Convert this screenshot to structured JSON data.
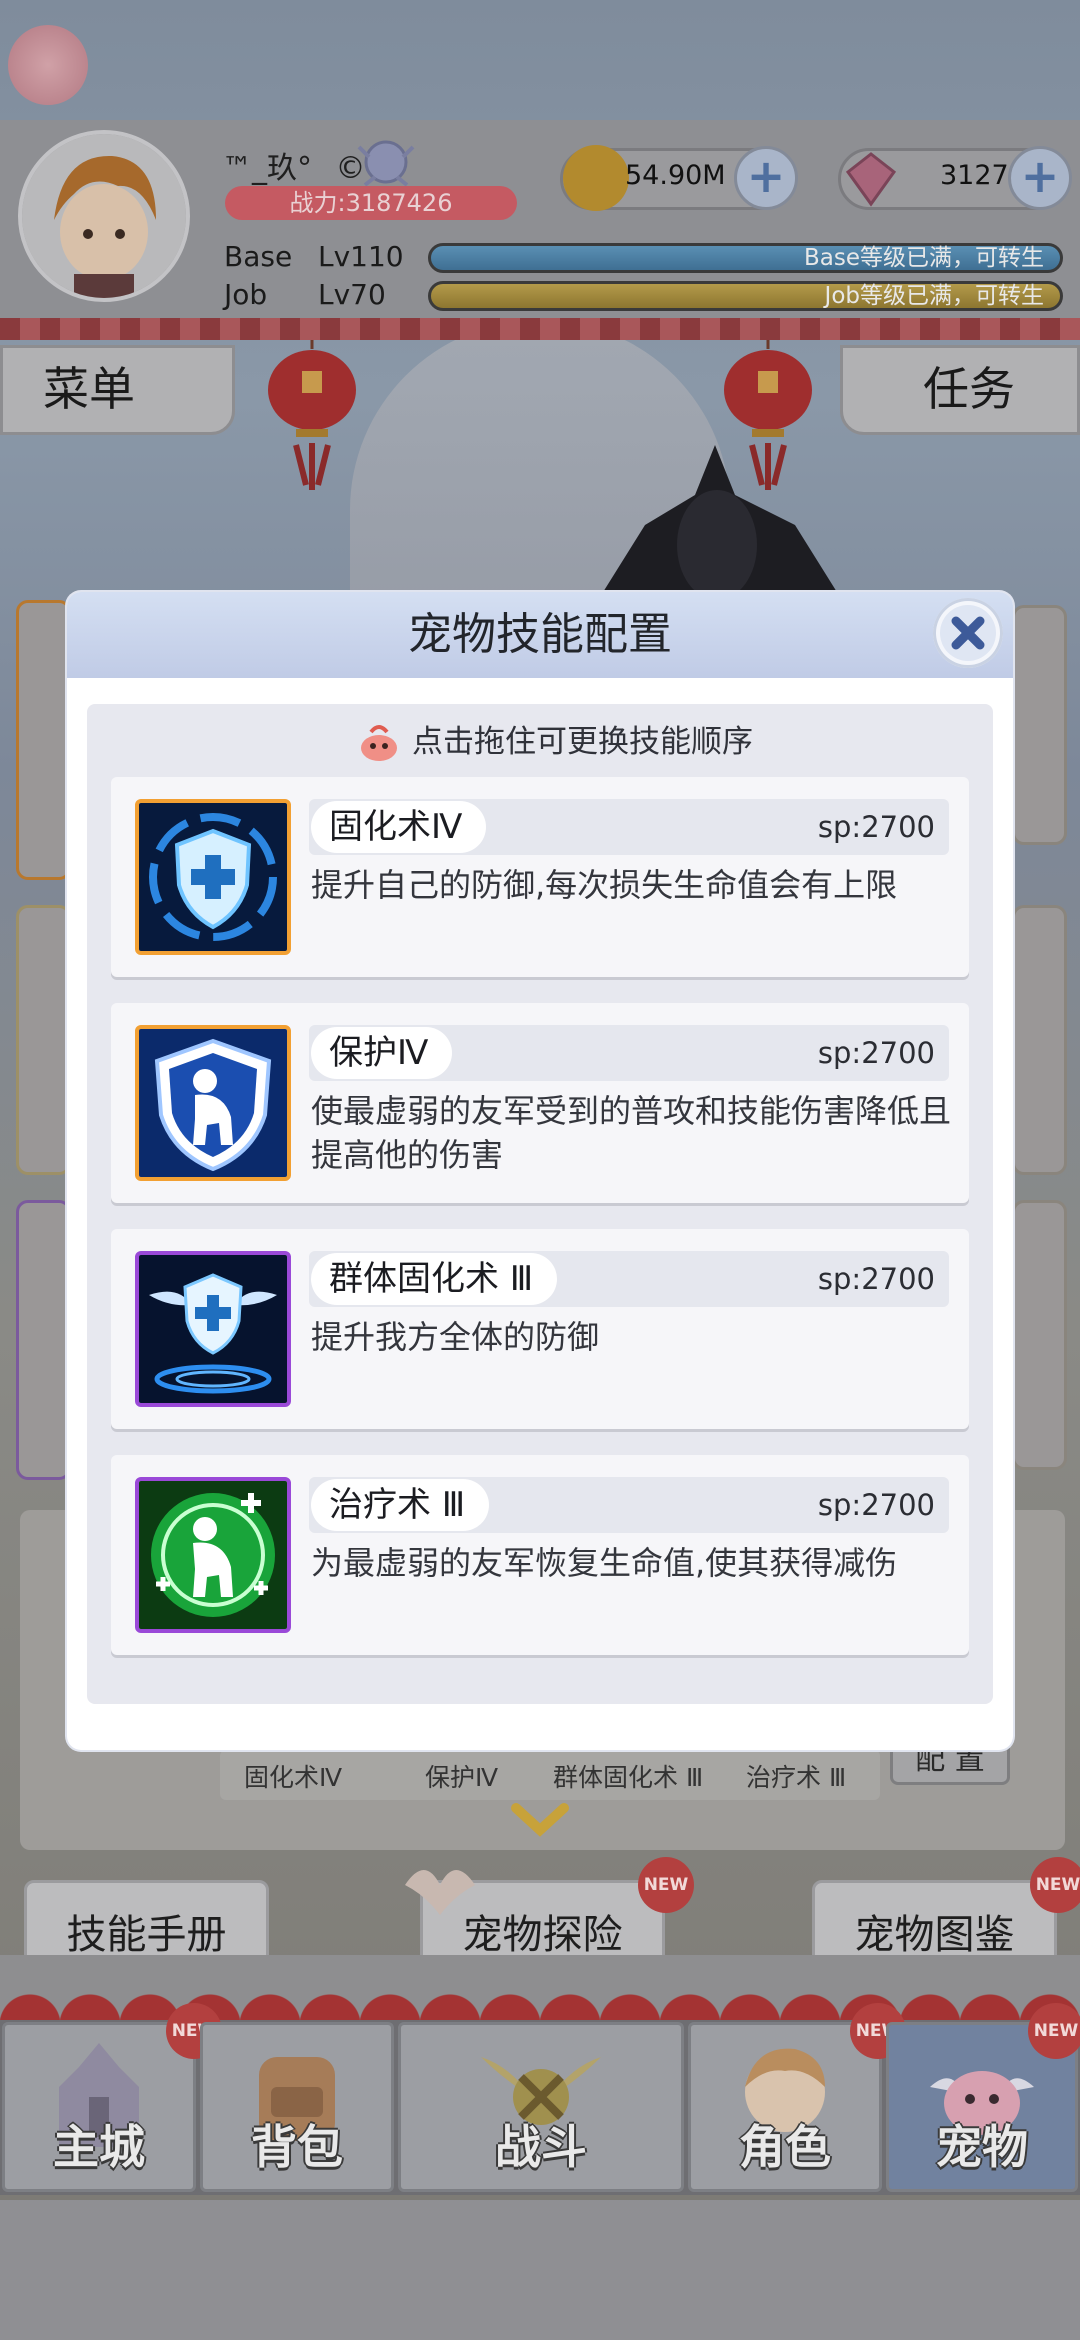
{
  "header": {
    "player_name": "™_玖°",
    "copyright_mark": "©",
    "power": "战力:3187426",
    "base_label": "Base",
    "base_level": "Lv110",
    "base_status": "Base等级已满，可转生",
    "job_label": "Job",
    "job_level": "Lv70",
    "job_status": "Job等级已满，可转生",
    "zeny": "54.90M",
    "gems": "3127",
    "plus_symbol": "+"
  },
  "side_tabs": {
    "menu": "菜单",
    "tasks": "任务"
  },
  "modal": {
    "title": "宠物技能配置",
    "hint": "点击拖住可更换技能顺序",
    "skills": [
      {
        "name": "固化术Ⅳ",
        "sp": "sp:2700",
        "desc": "提升自己的防御,每次损失生命值会有上限",
        "icon": "shield-cross-icon"
      },
      {
        "name": "保护Ⅳ",
        "sp": "sp:2700",
        "desc": "使最虚弱的友军受到的普攻和技能伤害降低且提高他的伤害",
        "icon": "shield-person-icon"
      },
      {
        "name": "群体固化术 Ⅲ",
        "sp": "sp:2700",
        "desc": "提升我方全体的防御",
        "icon": "winged-shield-icon"
      },
      {
        "name": "治疗术 Ⅲ",
        "sp": "sp:2700",
        "desc": "为最虚弱的友军恢复生命值,使其获得减伤",
        "icon": "heal-person-icon"
      }
    ]
  },
  "under_panel": {
    "tabs": [
      "固化术Ⅳ",
      "保护Ⅳ",
      "群体固化术 Ⅲ",
      "治疗术 Ⅲ"
    ],
    "config_label": "配 置"
  },
  "action_buttons": {
    "skill_manual": "技能手册",
    "pet_adventure": "宠物探险",
    "pet_codex": "宠物图鉴",
    "new_badge": "NEW"
  },
  "bottom_nav": [
    {
      "label": "主城",
      "new": true
    },
    {
      "label": "背包",
      "new": false
    },
    {
      "label": "战斗",
      "new": false
    },
    {
      "label": "角色",
      "new": true
    },
    {
      "label": "宠物",
      "new": true
    }
  ],
  "colors": {
    "modal_header": "#c8d3ec",
    "orange_frame": "#f2a033",
    "purple_frame": "#9a49d8",
    "close_x": "#3d5a99"
  }
}
